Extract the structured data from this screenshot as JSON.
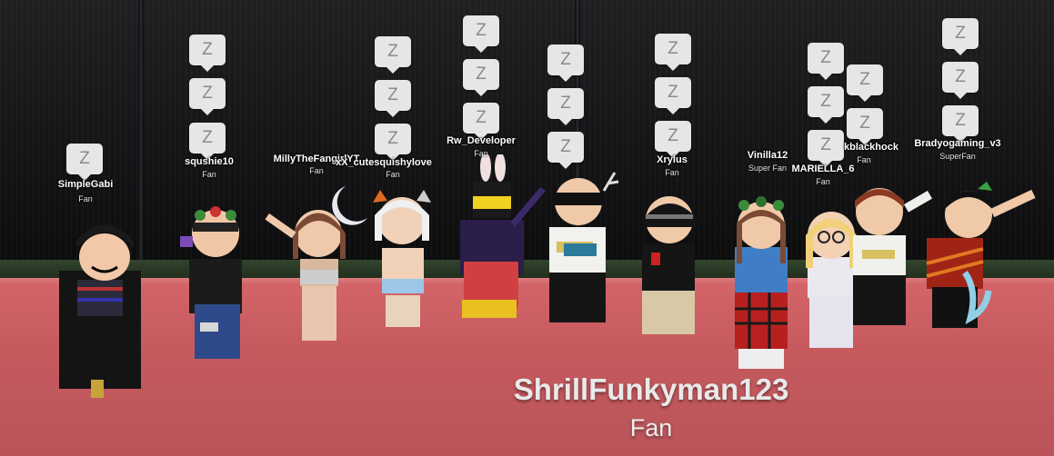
{
  "scene": {
    "sleep_glyph": "Z",
    "colors": {
      "stage": "#c55a5e",
      "wall": "#151517",
      "bubble": "#e6e6e6",
      "name_text": "#ffffff"
    }
  },
  "players": [
    {
      "name": "SimpleGabi",
      "rank": "Fan"
    },
    {
      "name": "squshie10",
      "rank": "Fan"
    },
    {
      "name": "MillyTheFangirlYT",
      "rank": "Fan"
    },
    {
      "name": "xX_cutesquishylove",
      "rank": "Fan"
    },
    {
      "name": "Rw_Developer",
      "rank": "Fan"
    },
    {
      "name": "Xrylus",
      "rank": "Fan"
    },
    {
      "name": "Vinilla12",
      "rank": "Super Fan"
    },
    {
      "name": "MARIELLA_6",
      "rank": "Fan"
    },
    {
      "name": "kblackhock",
      "rank": "Fan"
    },
    {
      "name": "Bradyogaming_v3",
      "rank": "SuperFan"
    }
  ],
  "focused_player": {
    "name": "ShrillFunkyman123",
    "rank": "Fan"
  }
}
